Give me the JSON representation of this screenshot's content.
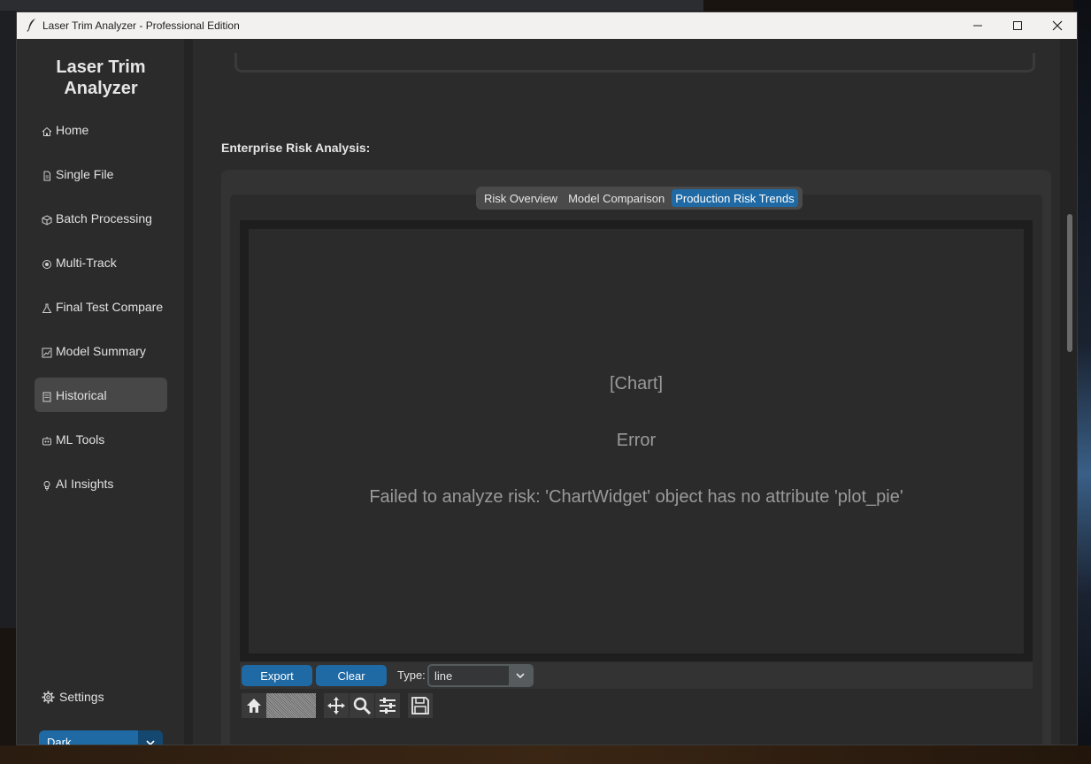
{
  "window": {
    "title": "Laser Trim Analyzer - Professional Edition"
  },
  "sidebar": {
    "brand": "Laser Trim Analyzer",
    "items": [
      {
        "label": "Home",
        "icon": "home-icon"
      },
      {
        "label": "Single File",
        "icon": "document-icon"
      },
      {
        "label": "Batch Processing",
        "icon": "package-icon"
      },
      {
        "label": "Multi-Track",
        "icon": "target-icon"
      },
      {
        "label": "Final Test Compare",
        "icon": "flask-icon"
      },
      {
        "label": "Model Summary",
        "icon": "chart-icon"
      },
      {
        "label": "Historical",
        "icon": "history-icon"
      },
      {
        "label": "ML Tools",
        "icon": "robot-icon"
      },
      {
        "label": "AI Insights",
        "icon": "lightbulb-icon"
      }
    ],
    "active_item": "Historical",
    "settings_label": "Settings",
    "theme": {
      "selected": "Dark"
    }
  },
  "main": {
    "section_title": "Enterprise Risk Analysis:",
    "tabs": [
      {
        "label": "Risk Overview"
      },
      {
        "label": "Model Comparison"
      },
      {
        "label": "Production Risk Trends"
      }
    ],
    "active_tab": "Production Risk Trends",
    "chart": {
      "placeholder": "[Chart]",
      "error_title": "Error",
      "error_message": "Failed to analyze risk: 'ChartWidget' object has no attribute 'plot_pie'"
    },
    "toolbar": {
      "export_label": "Export",
      "clear_label": "Clear",
      "type_label": "Type:",
      "type_value": "line"
    },
    "mpl_toolbar": [
      "home-icon",
      "back-icon",
      "forward-icon",
      "pan-icon",
      "zoom-icon",
      "configure-icon",
      "save-icon"
    ]
  },
  "colors": {
    "accent": "#1f6aa5",
    "sidebar_bg": "#2b2b2b",
    "active_nav": "#474747",
    "text": "#e1e1e1",
    "error_text": "#9a9a9a"
  }
}
